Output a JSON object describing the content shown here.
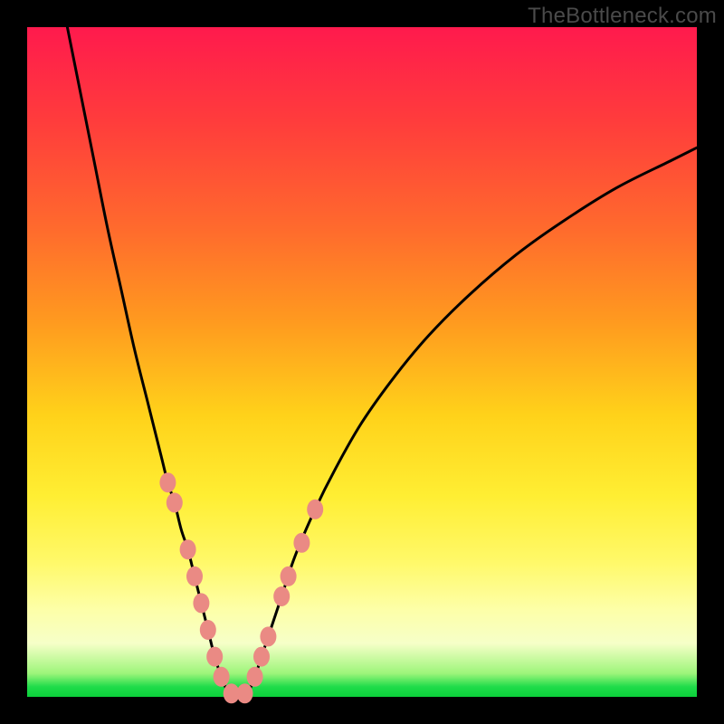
{
  "watermark": "TheBottleneck.com",
  "chart_data": {
    "type": "line",
    "title": "",
    "xlabel": "",
    "ylabel": "",
    "xlim": [
      0,
      100
    ],
    "ylim": [
      0,
      100
    ],
    "grid": false,
    "legend": false,
    "background_gradient": {
      "direction": "vertical",
      "stops": [
        {
          "pos": 0.0,
          "color": "#ff1a4d"
        },
        {
          "pos": 0.3,
          "color": "#ff6a2d"
        },
        {
          "pos": 0.58,
          "color": "#ffd21a"
        },
        {
          "pos": 0.8,
          "color": "#fff96a"
        },
        {
          "pos": 0.96,
          "color": "#9df57a"
        },
        {
          "pos": 1.0,
          "color": "#0bd13a"
        }
      ]
    },
    "series": [
      {
        "name": "left-branch",
        "stroke": "#000000",
        "x": [
          6,
          8,
          10,
          12,
          14,
          16,
          18,
          20,
          21,
          22,
          23,
          24,
          25,
          26,
          27,
          28,
          29,
          30
        ],
        "y": [
          100,
          90,
          80,
          70,
          61,
          52,
          44,
          36,
          32,
          29,
          25,
          22,
          18,
          14,
          10,
          6,
          3,
          0.5
        ]
      },
      {
        "name": "right-branch",
        "stroke": "#000000",
        "x": [
          33,
          34,
          35,
          36,
          38,
          40,
          43,
          46,
          50,
          55,
          60,
          66,
          73,
          80,
          88,
          96,
          100
        ],
        "y": [
          0.5,
          3,
          6,
          9,
          15,
          21,
          28,
          34,
          41,
          48,
          54,
          60,
          66,
          71,
          76,
          80,
          82
        ]
      },
      {
        "name": "valley-floor",
        "stroke": "#000000",
        "x": [
          30,
          31,
          32,
          33
        ],
        "y": [
          0.5,
          0.3,
          0.3,
          0.5
        ]
      }
    ],
    "markers": {
      "name": "highlighted-points",
      "shape": "ellipse",
      "fill": "#ea8a84",
      "stroke": "#ea8a84",
      "points": [
        {
          "x": 21.0,
          "y": 32
        },
        {
          "x": 22.0,
          "y": 29
        },
        {
          "x": 24.0,
          "y": 22
        },
        {
          "x": 25.0,
          "y": 18
        },
        {
          "x": 26.0,
          "y": 14
        },
        {
          "x": 27.0,
          "y": 10
        },
        {
          "x": 28.0,
          "y": 6
        },
        {
          "x": 29.0,
          "y": 3
        },
        {
          "x": 30.5,
          "y": 0.5
        },
        {
          "x": 32.5,
          "y": 0.5
        },
        {
          "x": 34.0,
          "y": 3
        },
        {
          "x": 35.0,
          "y": 6
        },
        {
          "x": 36.0,
          "y": 9
        },
        {
          "x": 38.0,
          "y": 15
        },
        {
          "x": 39.0,
          "y": 18
        },
        {
          "x": 41.0,
          "y": 23
        },
        {
          "x": 43.0,
          "y": 28
        }
      ]
    }
  }
}
